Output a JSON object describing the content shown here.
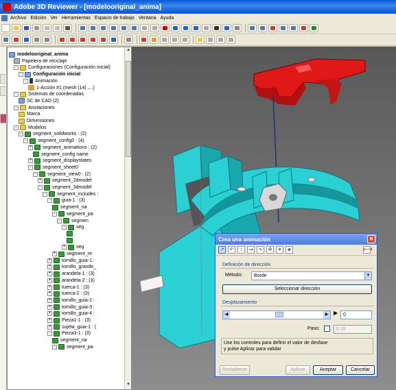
{
  "window": {
    "title": "Adobe 3D Reviewer - [modelooriginal_anima]"
  },
  "menu": [
    "Archivo",
    "Edición",
    "Ver",
    "Herramientas",
    "Espacio de trabajo",
    "Ventana",
    "Ayuda"
  ],
  "tree": [
    {
      "label": "modelooriginal_anima",
      "level": 0,
      "icon": "ic-cfg",
      "bold": true
    },
    {
      "label": "Papelera de reciclaje",
      "level": 1,
      "icon": "ic-bin"
    },
    {
      "label": "Configuraciones (Configuración inicial)",
      "level": 1,
      "icon": "ic-folder",
      "exp": "-"
    },
    {
      "label": "Configuración inicial",
      "level": 2,
      "icon": "ic-cfg",
      "exp": "-",
      "bold": true
    },
    {
      "label": "Animación",
      "level": 3,
      "icon": "ic-anim",
      "exp": "-"
    },
    {
      "label": "1-Acción #1 (mesh (14) ,...)",
      "level": 4,
      "icon": "ic-act"
    },
    {
      "label": "Sistemas de coordenadas",
      "level": 1,
      "icon": "ic-folder",
      "exp": "-"
    },
    {
      "label": "SC de CAD (2)",
      "level": 2,
      "icon": "ic-cfg"
    },
    {
      "label": "Anotaciones",
      "level": 1,
      "icon": "ic-folder",
      "exp": "-"
    },
    {
      "label": "Marca",
      "level": 2,
      "icon": "ic-folder"
    },
    {
      "label": "Dimensiones",
      "level": 2,
      "icon": "ic-folder"
    },
    {
      "label": "Modelos",
      "level": 1,
      "icon": "ic-folder",
      "exp": "-"
    },
    {
      "label": "segment_solidworks : (2)",
      "level": 2,
      "icon": "ic-seg",
      "exp": "-"
    },
    {
      "label": "segment_config0 : (4)",
      "level": 3,
      "icon": "ic-seg",
      "exp": "-"
    },
    {
      "label": "segment_animations : (2)",
      "level": 4,
      "icon": "ic-seg",
      "exp": "+"
    },
    {
      "label": "segment_config name",
      "level": 5,
      "icon": "ic-seg"
    },
    {
      "label": "segment_displaystates",
      "level": 4,
      "icon": "ic-seg",
      "exp": "+"
    },
    {
      "label": "segment_sheet0",
      "level": 4,
      "icon": "ic-seg",
      "exp": "-"
    },
    {
      "label": "segment_view0 : (2)",
      "level": 5,
      "icon": "ic-seg",
      "exp": "-"
    },
    {
      "label": "segment_2dmodel",
      "level": 6,
      "icon": "ic-seg",
      "exp": "+"
    },
    {
      "label": "segment_3dmodel",
      "level": 6,
      "icon": "ic-seg",
      "exp": "-"
    },
    {
      "label": "segment_includes :",
      "level": 7,
      "icon": "ic-seg",
      "exp": "-"
    },
    {
      "label": "guia-1 : (3)",
      "level": 8,
      "icon": "ic-seg",
      "exp": "-"
    },
    {
      "label": "segment_na",
      "level": 9,
      "icon": "ic-seg"
    },
    {
      "label": "segment_pa",
      "level": 9,
      "icon": "ic-seg",
      "exp": "-"
    },
    {
      "label": "segmen",
      "level": 10,
      "icon": "ic-seg",
      "exp": "-"
    },
    {
      "label": "seg",
      "level": 11,
      "icon": "ic-seg",
      "exp": "-"
    },
    {
      "label": "",
      "level": 12,
      "icon": "ic-seg"
    },
    {
      "label": "",
      "level": 12,
      "icon": "ic-seg"
    },
    {
      "label": "seg",
      "level": 11,
      "icon": "ic-seg",
      "exp": "+"
    },
    {
      "label": "segment_re",
      "level": 9,
      "icon": "ic-seg",
      "exp": "+"
    },
    {
      "label": "tornillo_guia-1 :",
      "level": 8,
      "icon": "ic-seg",
      "exp": "+"
    },
    {
      "label": "tornillo_grande_",
      "level": 8,
      "icon": "ic-seg",
      "exp": "+"
    },
    {
      "label": "arandela-1 : (3)",
      "level": 8,
      "icon": "ic-seg",
      "exp": "+"
    },
    {
      "label": "arandela-2 : (3)",
      "level": 8,
      "icon": "ic-seg",
      "exp": "+"
    },
    {
      "label": "tuerca-1 : (3)",
      "level": 8,
      "icon": "ic-seg",
      "exp": "+"
    },
    {
      "label": "tuerca-2 : (3)",
      "level": 8,
      "icon": "ic-seg",
      "exp": "+"
    },
    {
      "label": "tornillo_guia-2 :",
      "level": 8,
      "icon": "ic-seg",
      "exp": "+"
    },
    {
      "label": "tornillo_guia-3 :",
      "level": 8,
      "icon": "ic-seg",
      "exp": "+"
    },
    {
      "label": "tornillo_guia-4 :",
      "level": 8,
      "icon": "ic-seg",
      "exp": "+"
    },
    {
      "label": "Pieza1-1 : (3)",
      "level": 8,
      "icon": "ic-seg",
      "exp": "+"
    },
    {
      "label": "sujeta_guia-1 : (",
      "level": 8,
      "icon": "ic-seg",
      "exp": "+"
    },
    {
      "label": "Pieza3-1 : (3)",
      "level": 8,
      "icon": "ic-seg",
      "exp": "-"
    },
    {
      "label": "segment_na",
      "level": 9,
      "icon": "ic-seg"
    },
    {
      "label": "segment_pa",
      "level": 9,
      "icon": "ic-seg",
      "exp": "-"
    }
  ],
  "dialog": {
    "title": "Crea una animación",
    "direction_group": "Definición de dirección",
    "method_label": "Método:",
    "method_value": "Borde",
    "select_direction": "Seleccionar dirección",
    "offset_group": "Desplazamiento",
    "offset_value": "0",
    "step_label": "Paso:",
    "step_value": "0.10",
    "hint_line1": "Use los controles para definir el valor de desfase",
    "hint_line2": "y pulse Aplicar para validar",
    "reset": "Restablecer",
    "apply": "Aplicar",
    "accept": "Aceptar",
    "cancel": "Cancelar"
  },
  "colors": {
    "part_cyan": "#2ad0d4",
    "part_red": "#e01818",
    "title_blue": "#0a58d8"
  }
}
